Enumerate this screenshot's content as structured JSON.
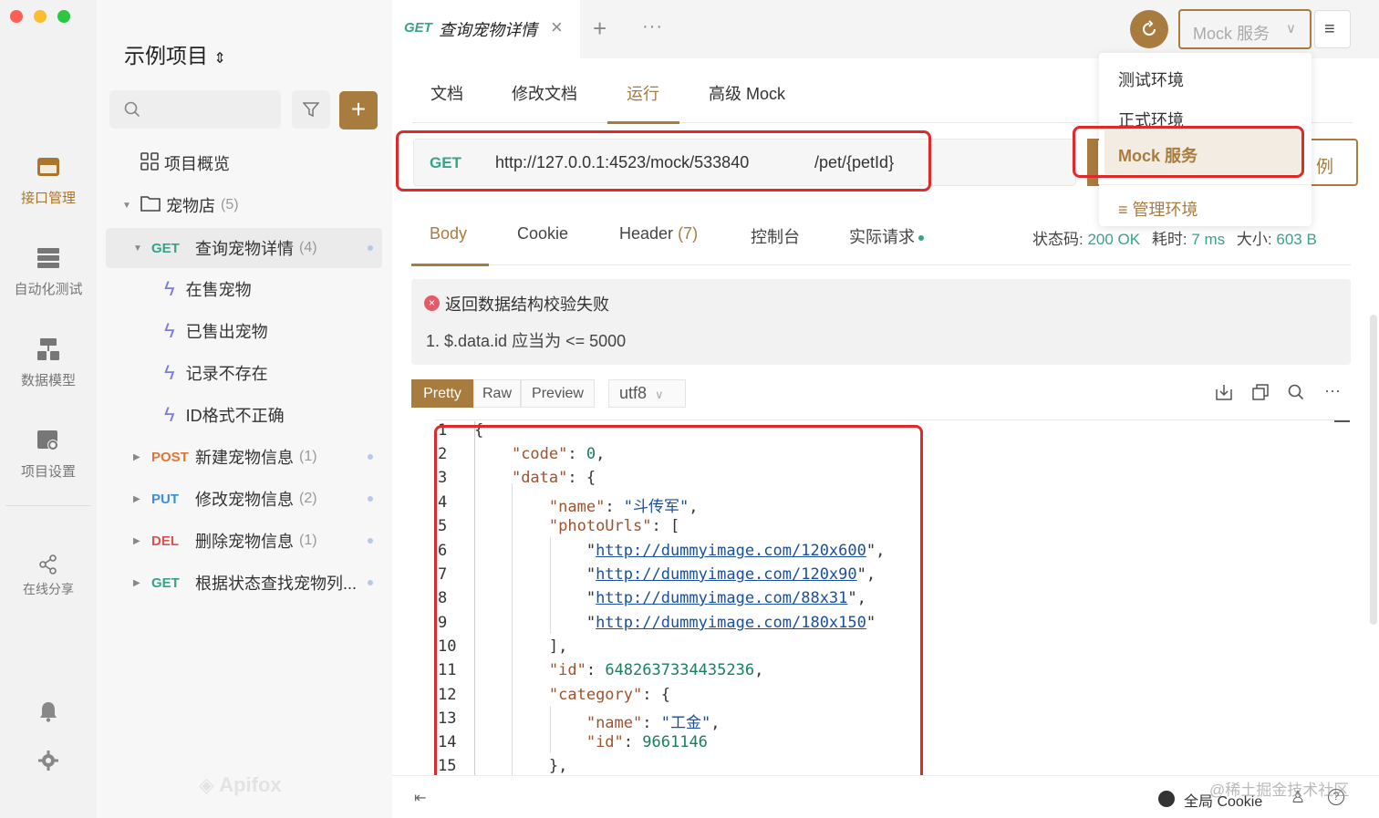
{
  "rail": {
    "items": [
      {
        "label": "接口管理",
        "icon": "api-management-icon"
      },
      {
        "label": "自动化测试",
        "icon": "auto-test-icon"
      },
      {
        "label": "数据模型",
        "icon": "data-model-icon"
      },
      {
        "label": "项目设置",
        "icon": "project-settings-icon"
      },
      {
        "label": "在线分享",
        "icon": "share-icon"
      }
    ],
    "brand": "Apifox"
  },
  "sidebar": {
    "project_name": "示例项目",
    "overview_label": "项目概览",
    "folder": {
      "label": "宠物店",
      "count": "(5)"
    },
    "items": [
      {
        "method": "GET",
        "label": "查询宠物详情",
        "count": "(4)"
      },
      {
        "label": "在售宠物"
      },
      {
        "label": "已售出宠物"
      },
      {
        "label": "记录不存在"
      },
      {
        "label": "ID格式不正确"
      },
      {
        "method": "POST",
        "label": "新建宠物信息",
        "count": "(1)"
      },
      {
        "method": "PUT",
        "label": "修改宠物信息",
        "count": "(2)"
      },
      {
        "method": "DEL",
        "label": "删除宠物信息",
        "count": "(1)"
      },
      {
        "method": "GET",
        "label": "根据状态查找宠物列..."
      }
    ]
  },
  "tabbar": {
    "active_method": "GET",
    "active_title": "查询宠物详情",
    "env_label": "Mock 服务"
  },
  "subtabs": [
    "文档",
    "修改文档",
    "运行",
    "高级 Mock"
  ],
  "request": {
    "method": "GET",
    "base_url": "http://127.0.0.1:4523/mock/533840",
    "path": "/pet/{petId}",
    "save_label": "例"
  },
  "env_menu": {
    "items": [
      "测试环境",
      "正式环境",
      "Mock 服务"
    ],
    "manage_label": "管理环境"
  },
  "response": {
    "tabs": [
      "Body",
      "Cookie",
      "Header",
      "控制台",
      "实际请求"
    ],
    "header_count": "(7)",
    "status_label": "状态码:",
    "status_value": "200 OK",
    "time_label": "耗时:",
    "time_value": "7 ms",
    "size_label": "大小:",
    "size_value": "603 B",
    "error_title": "返回数据结构校验失败",
    "error_detail": "1. $.data.id 应当为 <= 5000",
    "formats": [
      "Pretty",
      "Raw",
      "Preview"
    ],
    "encoding": "utf8"
  },
  "code_lines": [
    {
      "n": "1",
      "t": "{"
    },
    {
      "n": "2",
      "t": "    \"code\": 0,"
    },
    {
      "n": "3",
      "t": "    \"data\": {"
    },
    {
      "n": "4",
      "t": "        \"name\": \"斗传军\","
    },
    {
      "n": "5",
      "t": "        \"photoUrls\": ["
    },
    {
      "n": "6",
      "t": "            \"http://dummyimage.com/120x600\","
    },
    {
      "n": "7",
      "t": "            \"http://dummyimage.com/120x90\","
    },
    {
      "n": "8",
      "t": "            \"http://dummyimage.com/88x31\","
    },
    {
      "n": "9",
      "t": "            \"http://dummyimage.com/180x150\""
    },
    {
      "n": "10",
      "t": "        ],"
    },
    {
      "n": "11",
      "t": "        \"id\": 6482637334435236,"
    },
    {
      "n": "12",
      "t": "        \"category\": {"
    },
    {
      "n": "13",
      "t": "            \"name\": \"工金\","
    },
    {
      "n": "14",
      "t": "            \"id\": 9661146"
    },
    {
      "n": "15",
      "t": "        },"
    }
  ],
  "footer": {
    "cookie_label": "全局 Cookie",
    "watermark": "@稀土掘金技术社区"
  },
  "colors": {
    "accent": "#a87b3f",
    "get": "#36a38a",
    "post": "#e07534",
    "put": "#3a8de0",
    "del": "#d9534f",
    "highlight": "#e02a2a"
  }
}
